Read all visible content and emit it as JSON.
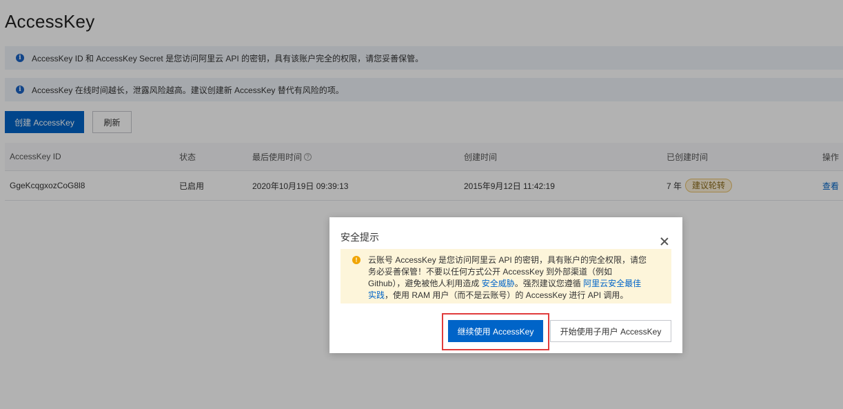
{
  "page": {
    "title": "AccessKey",
    "notices": [
      "AccessKey ID 和 AccessKey Secret 是您访问阿里云 API 的密钥，具有该账户完全的权限，请您妥善保管。",
      "AccessKey 在线时间越长，泄露风险越高。建议创建新 AccessKey 替代有风险的项。"
    ],
    "toolbar": {
      "create_label": "创建 AccessKey",
      "refresh_label": "刷新"
    },
    "table": {
      "headers": {
        "id": "AccessKey ID",
        "status": "状态",
        "last_used": "最后使用时间",
        "created": "创建时间",
        "age": "已创建时间",
        "ops": "操作"
      },
      "rows": [
        {
          "id": "GgeKcqgxozCoG8l8",
          "status": "已启用",
          "last_used": "2020年10月19日 09:39:13",
          "created": "2015年9月12日 11:42:19",
          "age": "7 年",
          "badge": "建议轮转",
          "op": "查看"
        }
      ]
    }
  },
  "dialog": {
    "title": "安全提示",
    "warning": {
      "line1": "云账号 AccessKey 是您访问阿里云 API 的密钥，具有账户的完全权限，请您",
      "line2": "务必妥善保管！不要以任何方式公开 AccessKey 到外部渠道（例如",
      "line3a": "Github），避免被他人利用造成 ",
      "link1": "安全威胁",
      "line3b": "。强烈建议您遵循 ",
      "link2a": "阿里云安全最佳",
      "link2b": "实践",
      "line4": "，使用 RAM 用户（而不是云账号）的 AccessKey 进行 API 调用。"
    },
    "continue_label": "继续使用 AccessKey",
    "subuser_label": "开始使用子用户 AccessKey"
  },
  "colors": {
    "primary": "#0064c8",
    "highlight": "#e03b3b",
    "warning_bg": "#fdf5da"
  }
}
